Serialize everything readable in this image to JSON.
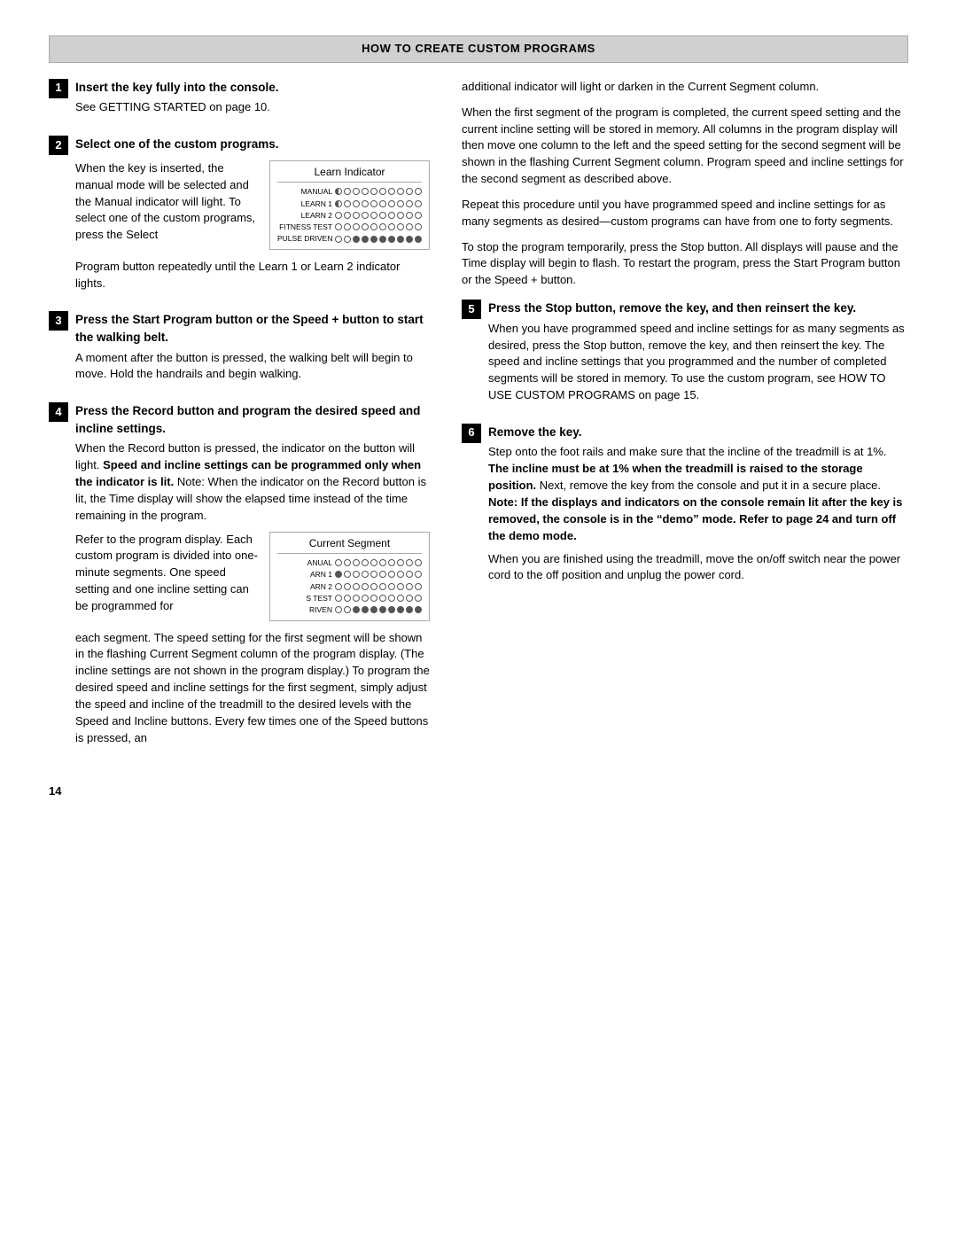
{
  "header": {
    "title": "HOW TO CREATE CUSTOM PROGRAMS"
  },
  "pageNumber": "14",
  "steps": [
    {
      "num": "1",
      "title": "Insert the key fully into the console.",
      "paragraphs": [
        "See GETTING STARTED on page 10."
      ]
    },
    {
      "num": "2",
      "title": "Select one of the custom programs.",
      "paragraphs": [
        "When the key is inserted, the manual mode will be selected and the Manual indicator will light. To select one of the custom programs, press the Select Program button repeatedly until the Learn 1 or Learn 2 indicator lights."
      ],
      "diagram": {
        "title": "Learn Indicator",
        "rows": [
          {
            "label": "MANUAL",
            "dots": [
              1,
              0,
              0,
              0,
              0,
              0,
              0,
              0,
              0,
              0
            ]
          },
          {
            "label": "LEARN 1",
            "dots": [
              0,
              0,
              0,
              0,
              0,
              0,
              0,
              0,
              0,
              0
            ]
          },
          {
            "label": "LEARN 2",
            "dots": [
              0,
              0,
              0,
              0,
              0,
              0,
              0,
              0,
              0,
              0
            ]
          },
          {
            "label": "FITNESS TEST",
            "dots": [
              0,
              0,
              0,
              0,
              0,
              0,
              0,
              0,
              0,
              0
            ]
          },
          {
            "label": "PULSE DRIVEN",
            "dots": [
              0,
              0,
              1,
              1,
              1,
              1,
              1,
              1,
              1,
              1
            ]
          }
        ]
      }
    },
    {
      "num": "3",
      "title": "Press the Start Program button or the Speed + button to start the walking belt.",
      "paragraphs": [
        "A moment after the button is pressed, the walking belt will begin to move. Hold the handrails and begin walking."
      ]
    },
    {
      "num": "4",
      "title": "Press the Record button and program the desired speed and incline settings.",
      "paragraphs": [
        "When the Record button is pressed, the indicator on the button will light. Speed and incline settings can be programmed only when the indicator is lit. Note: When the indicator on the Record button is lit, the Time display will show the elapsed time instead of the time remaining in the program.",
        "Refer to the program display. Each custom program is divided into one-minute segments. One speed setting and one incline setting can be programmed for each segment. The speed setting for the first segment will be shown in the flashing Current Segment column of the program display. (The incline settings are not shown in the program display.) To program the desired speed and incline settings for the first segment, simply adjust the speed and incline of the treadmill to the desired levels with the Speed and Incline buttons. Every few times one of the Speed buttons is pressed, an"
      ],
      "diagram": {
        "title": "Current Segment",
        "rows": [
          {
            "label": "ANUAL",
            "dots": [
              0,
              0,
              0,
              0,
              0,
              0,
              0,
              0,
              0,
              0
            ]
          },
          {
            "label": "ARN 1",
            "dots": [
              1,
              0,
              0,
              0,
              0,
              0,
              0,
              0,
              0,
              0
            ]
          },
          {
            "label": "ARN 2",
            "dots": [
              0,
              0,
              0,
              0,
              0,
              0,
              0,
              0,
              0,
              0
            ]
          },
          {
            "label": "S TEST",
            "dots": [
              0,
              0,
              0,
              0,
              0,
              0,
              0,
              0,
              0,
              0
            ]
          },
          {
            "label": "RIVEN",
            "dots": [
              0,
              0,
              1,
              1,
              1,
              1,
              1,
              1,
              1,
              1
            ]
          }
        ]
      }
    },
    {
      "num": "5",
      "title": "Press the Stop button, remove the key, and then reinsert the key.",
      "paragraphs": [
        "When you have programmed speed and incline settings for as many segments as desired, press the Stop button, remove the key, and then reinsert the key. The speed and incline settings that you programmed and the number of completed segments will be stored in memory. To use the custom program, see HOW TO USE CUSTOM PROGRAMS on page 15."
      ]
    },
    {
      "num": "6",
      "title": "Remove the key.",
      "paragraphs": [
        "Step onto the foot rails and make sure that the incline of the treadmill is at 1%. The incline must be at 1% when the treadmill is raised to the storage position. Next, remove the key from the console and put it in a secure place. Note: If the displays and indicators on the console remain lit after the key is removed, the console is in the “demo” mode. Refer to page 24 and turn off the demo mode.",
        "When you are finished using the treadmill, move the on/off switch near the power cord to the off position and unplug the power cord."
      ]
    }
  ],
  "rightColumn": {
    "paragraphs": [
      "additional indicator will light or darken in the Current Segment column.",
      "When the first segment of the program is completed, the current speed setting and the current incline setting will be stored in memory. All columns in the program display will then move one column to the left and the speed setting for the second segment will be shown in the flashing Current Segment column. Program speed and incline settings for the second segment as described above.",
      "Repeat this procedure until you have programmed speed and incline settings for as many segments as desired—custom programs can have from one to forty segments.",
      "To stop the program temporarily, press the Stop button. All displays will pause and the Time display will begin to flash. To restart the program, press the Start Program button or the Speed + button."
    ]
  }
}
